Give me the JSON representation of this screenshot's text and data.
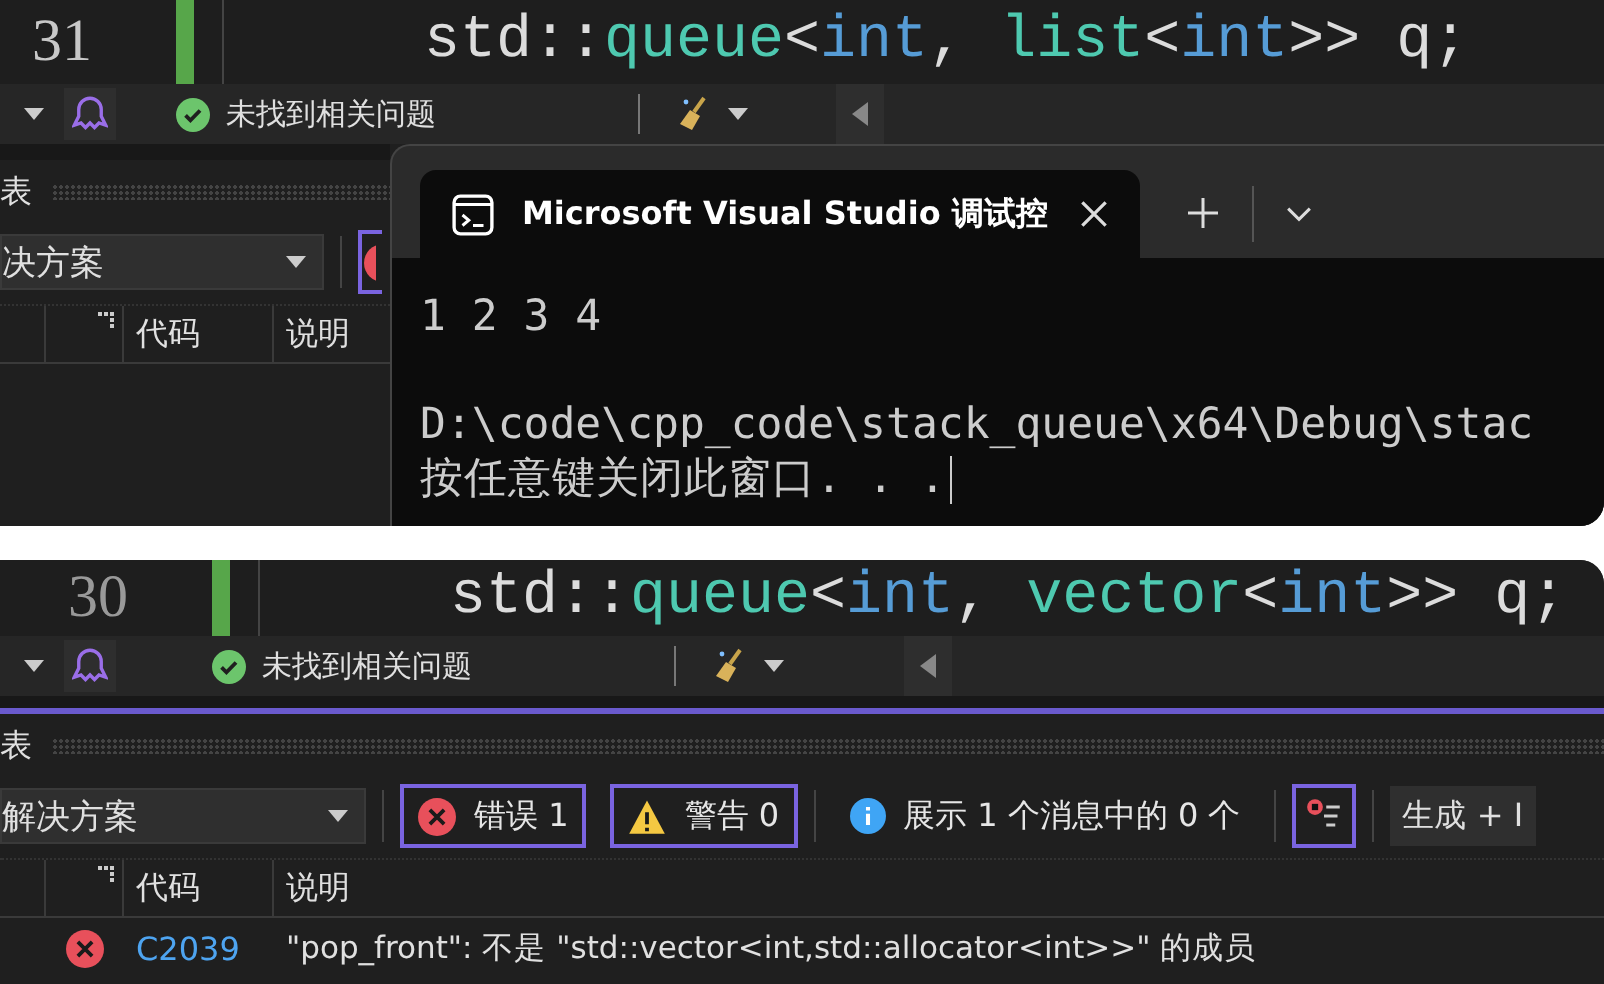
{
  "panels": [
    {
      "line_number": "31",
      "code": [
        {
          "text": "std::",
          "kind": "plain"
        },
        {
          "text": "queue",
          "kind": "type"
        },
        {
          "text": "<",
          "kind": "plain"
        },
        {
          "text": "int",
          "kind": "keyword"
        },
        {
          "text": ", ",
          "kind": "plain"
        },
        {
          "text": "list",
          "kind": "type"
        },
        {
          "text": "<",
          "kind": "plain"
        },
        {
          "text": "int",
          "kind": "keyword"
        },
        {
          "text": ">> q;",
          "kind": "plain"
        }
      ],
      "status": "未找到相关问题",
      "error_list": {
        "title": "表",
        "scope": "决方案",
        "buttons": [
          {
            "kind": "error",
            "selected": true
          }
        ],
        "headers": [
          "代码",
          "说明"
        ]
      },
      "console": {
        "tab_title": "Microsoft Visual Studio 调试控",
        "lines": [
          {
            "text": "1 2 3 4",
            "gap_before": false
          },
          {
            "text": "D:\\code\\cpp_code\\stack_queue\\x64\\Debug\\stac",
            "gap_before": true
          },
          {
            "text": "按任意键关闭此窗口. . .",
            "gap_before": false
          }
        ]
      }
    },
    {
      "line_number": "30",
      "code": [
        {
          "text": "std::",
          "kind": "plain"
        },
        {
          "text": "queue",
          "kind": "type"
        },
        {
          "text": "<",
          "kind": "plain"
        },
        {
          "text": "int",
          "kind": "keyword"
        },
        {
          "text": ", ",
          "kind": "plain"
        },
        {
          "text": "vector",
          "kind": "type"
        },
        {
          "text": "<",
          "kind": "plain"
        },
        {
          "text": "int",
          "kind": "keyword"
        },
        {
          "text": ">> q;",
          "kind": "plain"
        }
      ],
      "status": "未找到相关问题",
      "error_list": {
        "title": "表",
        "scope": "解决方案",
        "buttons": [
          {
            "kind": "error",
            "label": "错误 1",
            "selected": true
          },
          {
            "kind": "warning",
            "label": "警告 0",
            "selected": true
          },
          {
            "kind": "info",
            "label": "展示 1 个消息中的 0 个",
            "selected": false
          }
        ],
        "filter_selected": true,
        "source": "生成 + I",
        "headers": [
          "代码",
          "说明"
        ],
        "rows": [
          {
            "code": "C2039",
            "description": "\"pop_front\": 不是 \"std::vector<int,std::allocator<int>>\" 的成员"
          }
        ]
      }
    }
  ]
}
